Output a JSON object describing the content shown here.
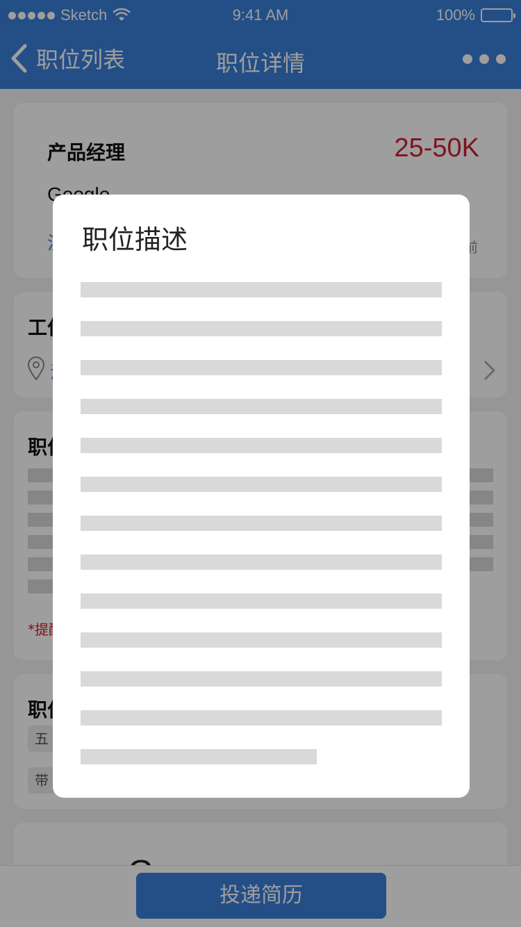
{
  "status": {
    "carrier": "Sketch",
    "time": "9:41 AM",
    "battery": "100%"
  },
  "nav": {
    "back_label": "职位列表",
    "title": "职位详情"
  },
  "job": {
    "title": "产品经理",
    "salary": "25-50K",
    "company": "Google",
    "location_partial": "沪",
    "side_text_partial": "前"
  },
  "sections": {
    "work_location_partial": "工作",
    "description_partial": "职位",
    "note_partial": "*提醒",
    "benefits_partial": "职位",
    "tag1_partial": "五",
    "tag2_partial": "带",
    "company_logo_partial": "Goo"
  },
  "bottom": {
    "submit_label": "投递简历"
  },
  "modal": {
    "title": "职位描述"
  },
  "colors": {
    "primary": "#3a7fd8",
    "salary": "#d0202a",
    "placeholder": "#d9d9d9"
  }
}
